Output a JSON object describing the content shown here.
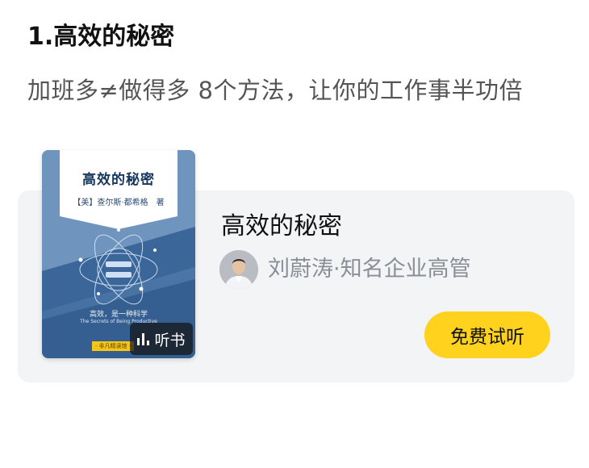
{
  "section": {
    "title": "1.高效的秘密",
    "subtitle": "加班多≠做得多 8个方法，让你的工作事半功倍"
  },
  "book_card": {
    "cover": {
      "title": "高效的秘密",
      "author": "【美】查尔斯·都希格　著",
      "tagline": "高效，是一种科学",
      "tagline_en": "The Secrets of Being Productive",
      "series": "· 非凡精读馆 ·"
    },
    "listen_badge": {
      "icon": "audio-bars-icon",
      "label": "听书"
    },
    "title": "高效的秘密",
    "author_line": "刘蔚涛·知名企业高管",
    "trial_button": "免费试听"
  },
  "colors": {
    "accent": "#FFD21E",
    "card_bg": "#F3F4F6",
    "cover_blue": "#4A76A8",
    "muted_text": "#8A8F96"
  }
}
